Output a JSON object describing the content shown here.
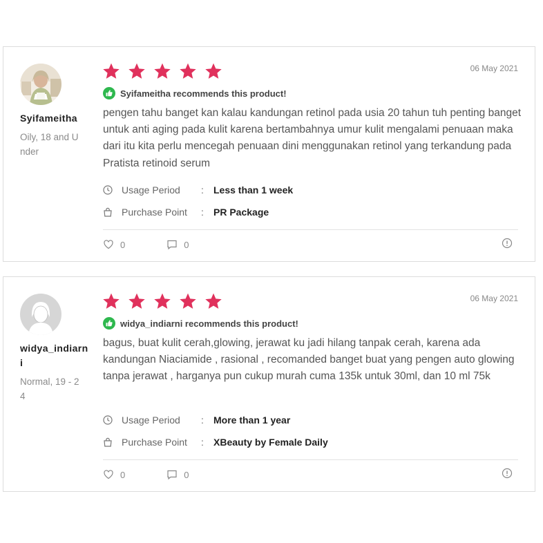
{
  "colors": {
    "star": "#e0315c",
    "recommend_badge": "#2eb84e"
  },
  "reviews": [
    {
      "username": "Syifameitha",
      "user_info": "Oily, 18 and Under",
      "date": "06 May 2021",
      "rating": 5,
      "recommend_text": "Syifameitha recommends this product!",
      "body": "pengen tahu banget kan kalau kandungan retinol pada usia 20 tahun tuh penting banget untuk anti aging pada kulit karena bertambahnya umur kulit mengalami penuaan maka dari itu kita perlu mencegah penuaan dini menggunakan retinol yang terkandung pada Pratista retinoid serum",
      "usage_label": "Usage Period",
      "usage_value": "Less than 1 week",
      "purchase_label": "Purchase Point",
      "purchase_value": "PR Package",
      "colon": ":",
      "likes": "0",
      "comments": "0",
      "avatar_icon": "user-photo-avatar"
    },
    {
      "username": "widya_indiarni",
      "user_info": "Normal, 19 - 24",
      "date": "06 May 2021",
      "rating": 5,
      "recommend_text": "widya_indiarni recommends this product!",
      "body": "bagus, buat kulit cerah,glowing, jerawat ku jadi hilang tanpak cerah, karena ada kandungan Niaciamide , rasional , recomanded banget buat yang pengen auto glowing tanpa jerawat , harganya pun cukup murah cuma 135k untuk 30ml, dan 10 ml 75k",
      "usage_label": "Usage Period",
      "usage_value": "More than 1 year",
      "purchase_label": "Purchase Point",
      "purchase_value": "XBeauty by Female Daily",
      "colon": ":",
      "likes": "0",
      "comments": "0",
      "avatar_icon": "default-user-avatar"
    }
  ]
}
